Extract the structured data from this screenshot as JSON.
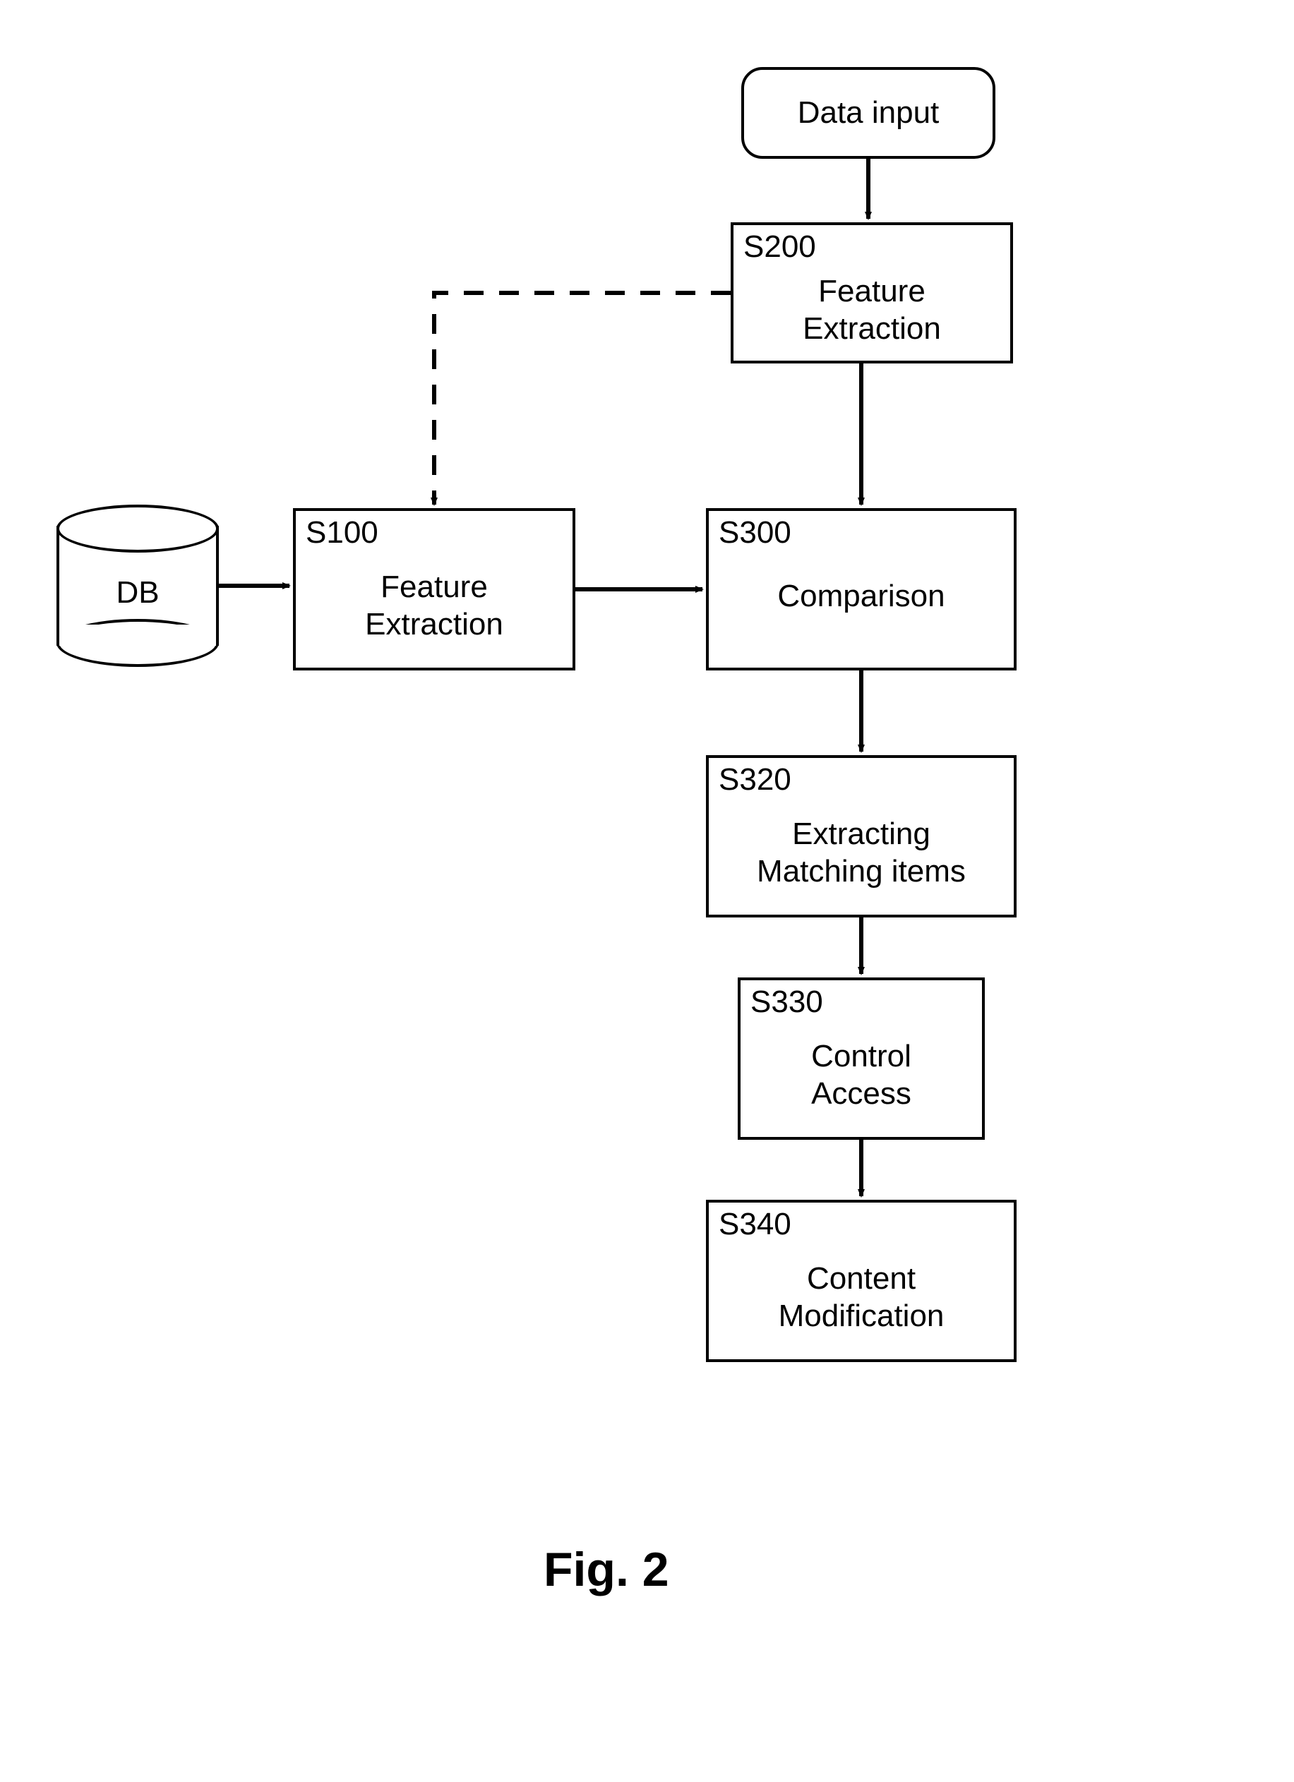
{
  "figure_label": "Fig. 2",
  "input_node": {
    "label": "Data input"
  },
  "db_node": {
    "label": "DB"
  },
  "steps": {
    "s100": {
      "id": "S100",
      "label": "Feature\nExtraction"
    },
    "s200": {
      "id": "S200",
      "label": "Feature\nExtraction"
    },
    "s300": {
      "id": "S300",
      "label": "Comparison"
    },
    "s320": {
      "id": "S320",
      "label": "Extracting\nMatching items"
    },
    "s330": {
      "id": "S330",
      "label": "Control\nAccess"
    },
    "s340": {
      "id": "S340",
      "label": "Content\nModification"
    }
  },
  "arrows": [
    {
      "from": "input",
      "to": "s200",
      "style": "solid"
    },
    {
      "from": "s200",
      "to": "s300",
      "style": "solid"
    },
    {
      "from": "s300",
      "to": "s320",
      "style": "solid"
    },
    {
      "from": "s320",
      "to": "s330",
      "style": "solid"
    },
    {
      "from": "s330",
      "to": "s340",
      "style": "solid"
    },
    {
      "from": "db",
      "to": "s100",
      "style": "solid"
    },
    {
      "from": "s100",
      "to": "s300",
      "style": "solid"
    },
    {
      "from": "s200",
      "to": "s100",
      "style": "dashed"
    }
  ]
}
